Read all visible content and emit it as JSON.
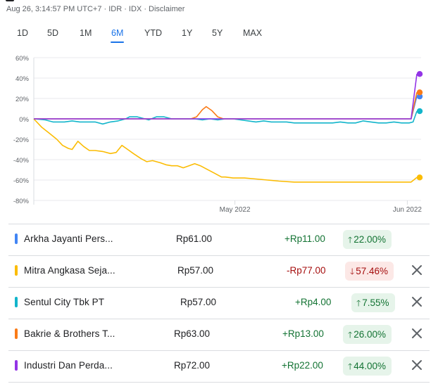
{
  "header": {
    "timestamp_line": "Aug 26, 3:14:57 PM UTC+7 · IDR · IDX · Disclaimer"
  },
  "ranges": {
    "items": [
      "1D",
      "5D",
      "1M",
      "6M",
      "YTD",
      "1Y",
      "5Y",
      "MAX"
    ],
    "selected": "6M"
  },
  "chart_data": {
    "type": "line",
    "y_unit": "%",
    "ylim": [
      -80,
      60
    ],
    "yticks": [
      "60%",
      "40%",
      "20%",
      "0%",
      "-20%",
      "-40%",
      "-60%",
      "-80%"
    ],
    "xticks": [
      "May 2022",
      "Jun 2022"
    ],
    "grid": true,
    "series": [
      {
        "name": "Arkha Jayanti Persada",
        "color": "#4285f4",
        "points": [
          [
            0,
            0
          ],
          [
            0.985,
            0
          ],
          [
            1,
            22
          ]
        ]
      },
      {
        "name": "Mitra Angkasa Sejahtera",
        "color": "#fbbc04",
        "points": [
          [
            0,
            0
          ],
          [
            0.02,
            -8
          ],
          [
            0.04,
            -14
          ],
          [
            0.06,
            -20
          ],
          [
            0.075,
            -26
          ],
          [
            0.09,
            -29
          ],
          [
            0.1,
            -30
          ],
          [
            0.115,
            -22
          ],
          [
            0.13,
            -27
          ],
          [
            0.145,
            -31
          ],
          [
            0.16,
            -31
          ],
          [
            0.18,
            -32
          ],
          [
            0.2,
            -34
          ],
          [
            0.215,
            -33
          ],
          [
            0.23,
            -26
          ],
          [
            0.245,
            -30
          ],
          [
            0.26,
            -34
          ],
          [
            0.28,
            -39
          ],
          [
            0.295,
            -42
          ],
          [
            0.31,
            -41
          ],
          [
            0.33,
            -43
          ],
          [
            0.345,
            -45
          ],
          [
            0.36,
            -46
          ],
          [
            0.375,
            -46
          ],
          [
            0.39,
            -48
          ],
          [
            0.405,
            -46
          ],
          [
            0.42,
            -44
          ],
          [
            0.435,
            -46
          ],
          [
            0.45,
            -49
          ],
          [
            0.47,
            -53
          ],
          [
            0.49,
            -57
          ],
          [
            0.5,
            -57
          ],
          [
            0.52,
            -58
          ],
          [
            0.55,
            -58
          ],
          [
            0.58,
            -59
          ],
          [
            0.61,
            -60
          ],
          [
            0.64,
            -61
          ],
          [
            0.68,
            -62
          ],
          [
            0.72,
            -62
          ],
          [
            0.76,
            -62
          ],
          [
            0.8,
            -62
          ],
          [
            0.85,
            -62
          ],
          [
            0.9,
            -62
          ],
          [
            0.95,
            -62
          ],
          [
            0.985,
            -62
          ],
          [
            1,
            -57.46
          ]
        ]
      },
      {
        "name": "Sentul City Tbk PT",
        "color": "#12b5cb",
        "points": [
          [
            0,
            0
          ],
          [
            0.03,
            -1
          ],
          [
            0.05,
            -3
          ],
          [
            0.08,
            -3
          ],
          [
            0.1,
            -2
          ],
          [
            0.12,
            -3
          ],
          [
            0.14,
            -3
          ],
          [
            0.16,
            -3
          ],
          [
            0.18,
            -5
          ],
          [
            0.2,
            -3
          ],
          [
            0.22,
            -2
          ],
          [
            0.24,
            0
          ],
          [
            0.25,
            2
          ],
          [
            0.27,
            2
          ],
          [
            0.29,
            0
          ],
          [
            0.3,
            -1
          ],
          [
            0.32,
            2
          ],
          [
            0.34,
            2
          ],
          [
            0.36,
            0
          ],
          [
            0.38,
            0
          ],
          [
            0.4,
            0
          ],
          [
            0.42,
            0
          ],
          [
            0.44,
            -1
          ],
          [
            0.46,
            0
          ],
          [
            0.48,
            -1
          ],
          [
            0.5,
            0
          ],
          [
            0.52,
            0
          ],
          [
            0.54,
            -1
          ],
          [
            0.56,
            -2
          ],
          [
            0.58,
            -3
          ],
          [
            0.6,
            -2
          ],
          [
            0.62,
            -3
          ],
          [
            0.64,
            -3
          ],
          [
            0.66,
            -3
          ],
          [
            0.68,
            -4
          ],
          [
            0.7,
            -4
          ],
          [
            0.72,
            -4
          ],
          [
            0.74,
            -4
          ],
          [
            0.76,
            -4
          ],
          [
            0.78,
            -4
          ],
          [
            0.8,
            -3
          ],
          [
            0.82,
            -4
          ],
          [
            0.84,
            -4
          ],
          [
            0.86,
            -2
          ],
          [
            0.88,
            -3
          ],
          [
            0.9,
            -4
          ],
          [
            0.92,
            -4
          ],
          [
            0.94,
            -3
          ],
          [
            0.96,
            -4
          ],
          [
            0.98,
            -4
          ],
          [
            0.99,
            -3
          ],
          [
            1,
            7.55
          ]
        ]
      },
      {
        "name": "Bakrie & Brothers Tbk",
        "color": "#fa7b17",
        "points": [
          [
            0,
            0
          ],
          [
            0.41,
            0
          ],
          [
            0.425,
            2
          ],
          [
            0.44,
            9
          ],
          [
            0.45,
            12
          ],
          [
            0.465,
            8
          ],
          [
            0.48,
            2
          ],
          [
            0.495,
            0
          ],
          [
            0.985,
            0
          ],
          [
            1,
            26
          ]
        ]
      },
      {
        "name": "Industri Dan Perdagangan",
        "color": "#9334e6",
        "points": [
          [
            0,
            0
          ],
          [
            0.985,
            0
          ],
          [
            1,
            44
          ]
        ]
      }
    ]
  },
  "rows": [
    {
      "name": "Arkha Jayanti Pers...",
      "color": "#4285f4",
      "price": "Rp61.00",
      "change": "+Rp11.00",
      "pct": "22.00%",
      "dir": "up",
      "removable": false
    },
    {
      "name": "Mitra Angkasa Seja...",
      "color": "#fbbc04",
      "price": "Rp57.00",
      "change": "-Rp77.00",
      "pct": "57.46%",
      "dir": "down",
      "removable": true
    },
    {
      "name": "Sentul City Tbk PT",
      "color": "#12b5cb",
      "price": "Rp57.00",
      "change": "+Rp4.00",
      "pct": "7.55%",
      "dir": "up",
      "removable": true
    },
    {
      "name": "Bakrie & Brothers T...",
      "color": "#fa7b17",
      "price": "Rp63.00",
      "change": "+Rp13.00",
      "pct": "26.00%",
      "dir": "up",
      "removable": true
    },
    {
      "name": "Industri Dan Perda...",
      "color": "#9334e6",
      "price": "Rp72.00",
      "change": "+Rp22.00",
      "pct": "44.00%",
      "dir": "up",
      "removable": true
    }
  ],
  "icons": {
    "up": "arrow-up-icon",
    "down": "arrow-down-icon",
    "close": "close-icon"
  }
}
